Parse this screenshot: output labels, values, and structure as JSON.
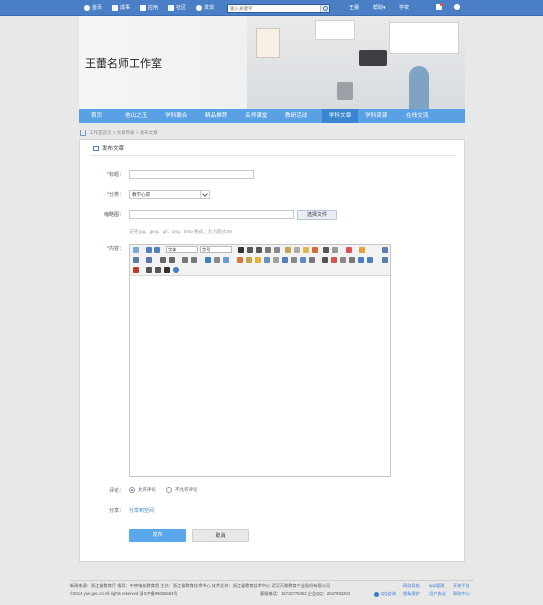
{
  "topbar": {
    "items": [
      {
        "label": "首页",
        "icon": "home-icon"
      },
      {
        "label": "成事",
        "icon": "book-icon"
      },
      {
        "label": "应用",
        "icon": "grid-icon"
      },
      {
        "label": "社区",
        "icon": "chat-icon"
      },
      {
        "label": "发现",
        "icon": "compass-icon"
      }
    ],
    "search_placeholder": "输入关键字",
    "user": "王蕾",
    "menu": "帮助▾",
    "subject": "学校"
  },
  "banner": {
    "title": "王蕾名师工作室"
  },
  "nav": {
    "items": [
      "首页",
      "他山之玉",
      "学科聚合",
      "精品推荐",
      "名师课堂",
      "教研活动",
      "学科文章",
      "学科资源",
      "在线交流"
    ],
    "active_index": 6
  },
  "breadcrumb": {
    "text": "工作室首页 > 文章列表 > 发布文章"
  },
  "form": {
    "heading": "发布文章",
    "title_label": "标题：",
    "title_value": "",
    "category_label": "分类：",
    "category_value": "教学心得",
    "thumb_label": "缩略图：",
    "thumb_value": "",
    "choose_file": "选择文件",
    "thumb_hint": "支持 jpg、jpeg、gif、png、bmp 格式，大小超过2M",
    "content_label": "内容：",
    "font_family": "字体",
    "font_size": "字号",
    "comment_label": "评论：",
    "comment_options": [
      "允许评论",
      "不允许评论"
    ],
    "comment_selected": 0,
    "share_label": "分享：",
    "share_link": "分享到空间",
    "submit": "发布",
    "cancel": "取消"
  },
  "footer": {
    "line1": "新闻来源：浙江省数育厅  指导：中央电化教育馆  主办：浙江省教育技术中心     技术支持：浙江省教育技术中心  武汉天喻教育产业股份有限公司",
    "line2": "©2014 yun.gec.cn All rights reserved    浙ICP备05006663号",
    "line2b": "客服电话：15715776452 企业QQ：2047993204",
    "links_row1": [
      "网站导航",
      "app管理",
      "开放平台"
    ],
    "links_row2": [
      "隐私保护",
      "用户协议",
      "帮助中心"
    ],
    "qq_label": "QQ咨询"
  },
  "colors": {
    "topbar": "#4a7fc6",
    "nav": "#5aa0e4",
    "primary_button": "#5aa7ec"
  }
}
